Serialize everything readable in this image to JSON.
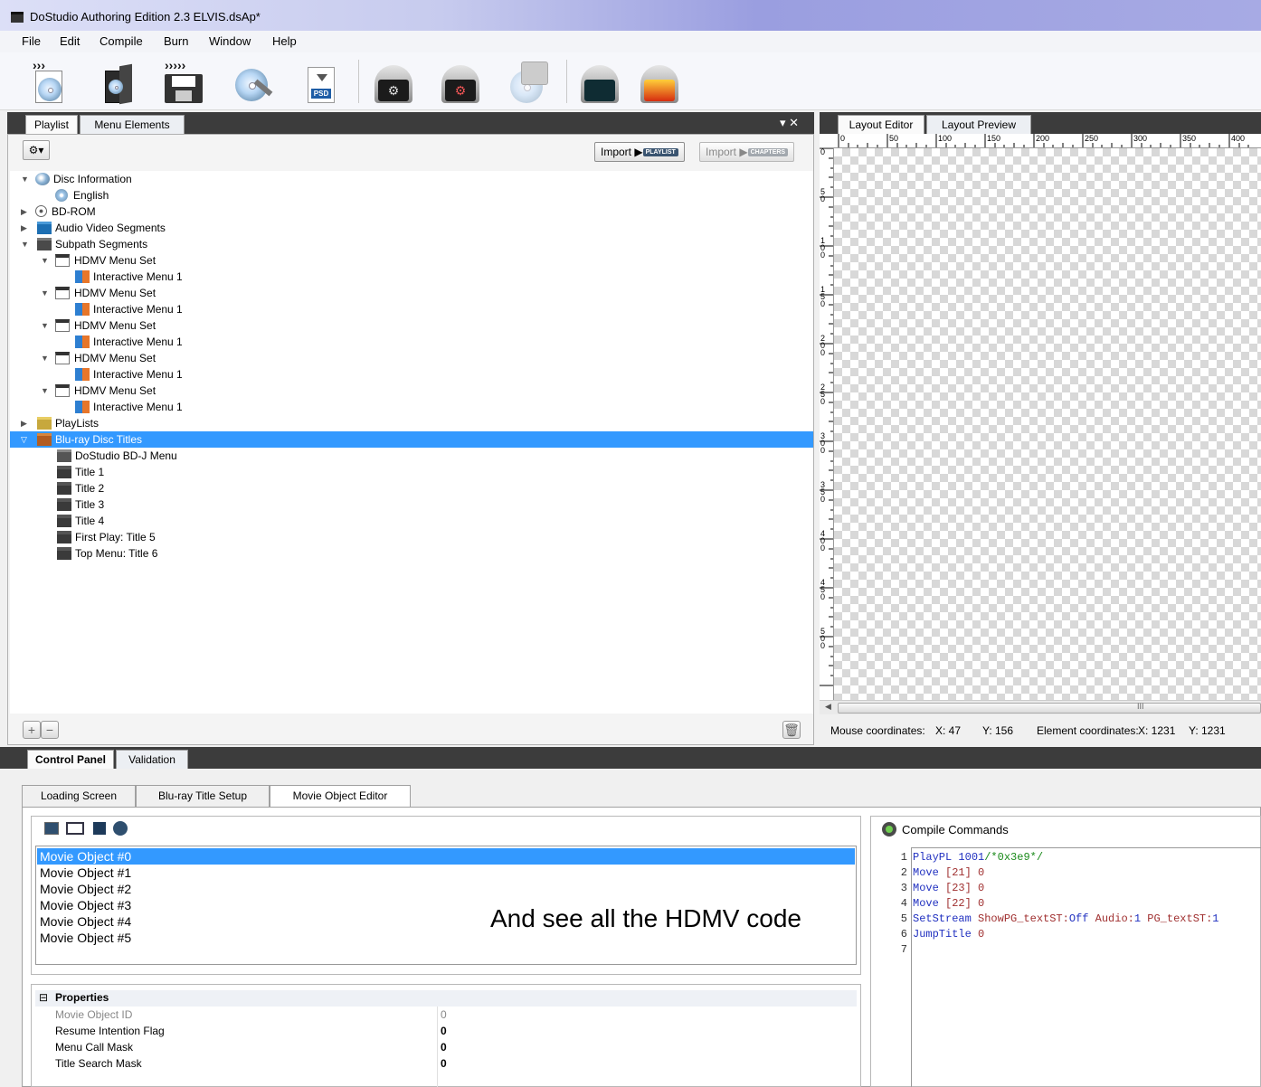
{
  "window": {
    "title": "DoStudio Authoring Edition 2.3 ELVIS.dsAp*"
  },
  "menu": [
    "File",
    "Edit",
    "Compile",
    "Burn",
    "Window",
    "Help"
  ],
  "toolbar": {
    "buttons": [
      "new-project",
      "open-project",
      "save-project",
      "disc-settings",
      "import-psd",
      "compile",
      "compile-advanced",
      "preview",
      "build-image",
      "burn"
    ]
  },
  "left_panel": {
    "tabs": [
      "Playlist",
      "Menu Elements"
    ],
    "controls": "▾ ✕",
    "import_playlist": {
      "label": "Import",
      "tag": "PLAYLIST"
    },
    "import_chapters": {
      "label": "Import",
      "tag": "CHAPTERS"
    },
    "tree": [
      {
        "label": "Disc Information",
        "icon": "disc-info-icon"
      },
      {
        "label": "English",
        "icon": "language-icon"
      },
      {
        "label": "BD-ROM",
        "icon": "bd-rom-icon"
      },
      {
        "label": "Audio Video Segments",
        "icon": "folder-icon"
      },
      {
        "label": "Subpath Segments",
        "icon": "folder-icon"
      },
      {
        "label": "HDMV Menu Set",
        "icon": "menu-set-icon"
      },
      {
        "label": "Interactive Menu 1",
        "icon": "interactive-menu-icon"
      },
      {
        "label": "HDMV Menu Set",
        "icon": "menu-set-icon"
      },
      {
        "label": "Interactive Menu 1",
        "icon": "interactive-menu-icon"
      },
      {
        "label": "HDMV Menu Set",
        "icon": "menu-set-icon"
      },
      {
        "label": "Interactive Menu 1",
        "icon": "interactive-menu-icon"
      },
      {
        "label": "HDMV Menu Set",
        "icon": "menu-set-icon"
      },
      {
        "label": "Interactive Menu 1",
        "icon": "interactive-menu-icon"
      },
      {
        "label": "HDMV Menu Set",
        "icon": "menu-set-icon"
      },
      {
        "label": "Interactive Menu 1",
        "icon": "interactive-menu-icon"
      },
      {
        "label": "PlayLists",
        "icon": "folder-icon"
      },
      {
        "label": "Blu-ray Disc Titles",
        "icon": "folder-icon",
        "selected": true
      },
      {
        "label": "DoStudio BD-J Menu",
        "icon": "bdj-menu-icon"
      },
      {
        "label": "Title 1",
        "icon": "title-icon"
      },
      {
        "label": "Title 2",
        "icon": "title-icon"
      },
      {
        "label": "Title 3",
        "icon": "title-icon"
      },
      {
        "label": "Title 4",
        "icon": "title-icon"
      },
      {
        "label": "First Play: Title 5",
        "icon": "title-icon"
      },
      {
        "label": "Top Menu: Title 6",
        "icon": "title-icon"
      }
    ]
  },
  "right_panel": {
    "tabs": [
      "Layout Editor",
      "Layout Preview"
    ],
    "ruler_h": [
      "0",
      "50",
      "100",
      "150",
      "200",
      "250",
      "300",
      "350",
      "400"
    ],
    "ruler_v": [
      "0",
      "50",
      "100",
      "150",
      "200",
      "250",
      "300",
      "350",
      "400",
      "450",
      "500"
    ],
    "hscroll_grip": "III",
    "status": {
      "mouse_label": "Mouse coordinates:",
      "mouse_x": "X: 47",
      "mouse_y": "Y: 156",
      "element_label": "Element coordinates:",
      "element_x": "X: 1231",
      "element_y": "Y: 1231"
    }
  },
  "bottom": {
    "tabs": [
      "Control Panel",
      "Validation"
    ],
    "inner_tabs": [
      "Loading Screen",
      "Blu-ray Title Setup",
      "Movie Object Editor"
    ],
    "movie_objects": [
      "Movie Object #0",
      "Movie Object #1",
      "Movie Object #2",
      "Movie Object #3",
      "Movie Object #4",
      "Movie Object #5"
    ],
    "annotation": "And see all the HDMV code",
    "properties": {
      "header": "Properties",
      "rows": [
        {
          "name": "Movie Object ID",
          "value": "0"
        },
        {
          "name": "Resume Intention Flag",
          "value": "0"
        },
        {
          "name": "Menu Call Mask",
          "value": "0"
        },
        {
          "name": "Title Search Mask",
          "value": "0"
        }
      ]
    },
    "compile": {
      "title": "Compile Commands",
      "lines": [
        [
          {
            "t": "PlayPL",
            "c": "#2030c0"
          },
          {
            "t": " 1001",
            "c": "#2030c0"
          },
          {
            "t": "/*0x3e9*/",
            "c": "#1a8a1a"
          }
        ],
        [
          {
            "t": "Move",
            "c": "#2030c0"
          },
          {
            "t": " [21] 0",
            "c": "#a03030"
          }
        ],
        [
          {
            "t": "Move",
            "c": "#2030c0"
          },
          {
            "t": " [23] 0",
            "c": "#a03030"
          }
        ],
        [
          {
            "t": "Move",
            "c": "#2030c0"
          },
          {
            "t": " [22] 0",
            "c": "#a03030"
          }
        ],
        [
          {
            "t": "SetStream",
            "c": "#2030c0"
          },
          {
            "t": " ShowPG_textST:",
            "c": "#a03030"
          },
          {
            "t": "Off",
            "c": "#2030c0"
          },
          {
            "t": " Audio:",
            "c": "#a03030"
          },
          {
            "t": "1",
            "c": "#2030c0"
          },
          {
            "t": " PG_textST:",
            "c": "#a03030"
          },
          {
            "t": "1",
            "c": "#2030c0"
          }
        ],
        [
          {
            "t": "JumpTitle",
            "c": "#2030c0"
          },
          {
            "t": " 0",
            "c": "#a03030"
          }
        ],
        []
      ]
    }
  }
}
